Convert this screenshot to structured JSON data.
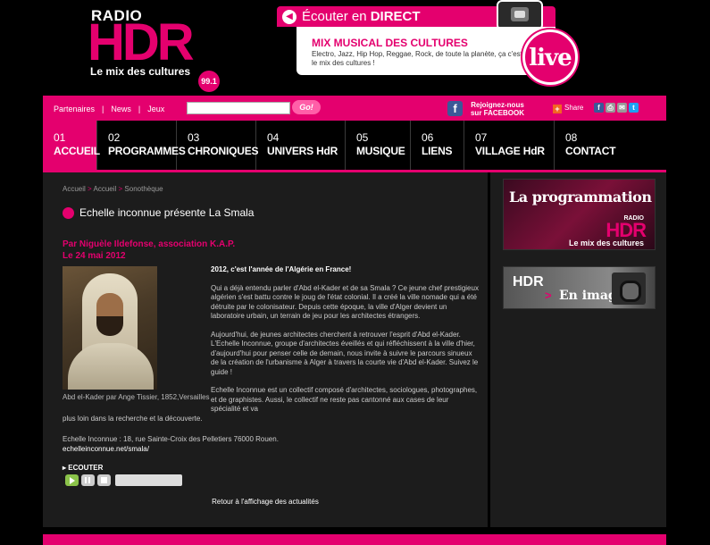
{
  "header": {
    "logo": {
      "radio": "RADIO",
      "hdr": "HDR",
      "tagline": "Le mix des cultures",
      "frequency": "99.1"
    },
    "live": {
      "listen_prefix": "Écouter en",
      "listen_bold": "DIRECT",
      "mix_title": "MIX MUSICAL DES CULTURES",
      "mix_text": "Electro, Jazz, Hip Hop, Reggae, Rock, de toute la planète, ça c'est le mix des cultures !",
      "live_label": "live"
    }
  },
  "topbar": {
    "links": [
      "Partenaires",
      "News",
      "Jeux"
    ],
    "search": {
      "value": "",
      "placeholder": ""
    },
    "go_label": "Go!",
    "facebook_text": "Rejoignez-nous sur FACEBOOK",
    "share_label": "Share",
    "social_icons": [
      "facebook-icon",
      "print-icon",
      "email-icon",
      "twitter-icon"
    ]
  },
  "nav": [
    {
      "num": "01",
      "label": "ACCUEIL",
      "active": true
    },
    {
      "num": "02",
      "label": "PROGRAMMES"
    },
    {
      "num": "03",
      "label": "CHRONIQUES"
    },
    {
      "num": "04",
      "label": "UNIVERS HdR"
    },
    {
      "num": "05",
      "label": "MUSIQUE"
    },
    {
      "num": "06",
      "label": "LIENS"
    },
    {
      "num": "07",
      "label": "VILLAGE HdR"
    },
    {
      "num": "08",
      "label": "CONTACT"
    }
  ],
  "breadcrumb": {
    "items": [
      "Accueil",
      "Accueil",
      "Sonothèque"
    ]
  },
  "article": {
    "title": "Echelle inconnue présente La Smala",
    "author": "Par Niguèle Ildefonse, association K.A.P.",
    "date": "Le 24 mai 2012",
    "image_caption": "Abd el-Kader par Ange Tissier, 1852,Versailles",
    "lead": "2012, c'est l'année de l'Algérie en France!",
    "p1": "Qui a déjà entendu parler d'Abd el-Kader et de sa Smala ? Ce jeune chef prestigieux algérien s'est battu contre le joug de l'état colonial. Il a créé la ville nomade qui a été détruite par le colonisateur. Depuis cette époque, la ville d'Alger devient un laboratoire urbain, un terrain de jeu pour les architectes étrangers.",
    "p2": "Aujourd'hui, de jeunes architectes cherchent à retrouver l'esprit d'Abd el-Kader. L'Echelle Inconnue, groupe d'architectes éveillés et qui réfléchissent à la ville d'hier, d'aujourd'hui pour penser celle de demain, nous invite à suivre le parcours sinueux de la création de l'urbanisme à Alger à travers la courte vie d'Abd el-Kader. Suivez le guide !",
    "p3": "Echelle Inconnue est un collectif composé d'architectes, sociologues, photographes, et de graphistes. Aussi, le collectif ne reste pas cantonné aux cases de leur spécialité et va",
    "p3_cont": "plus loin dans la recherche et la découverte.",
    "address": "Echelle Inconnue : 18, rue Sainte-Croix des Pelletiers 76000 Rouen.",
    "website": "echelleinconnue.net/smala/",
    "listen_label": "▸ ECOUTER",
    "back_link": "Retour à l'affichage des actualités"
  },
  "sidebar": {
    "promo1": {
      "title": "La programmation",
      "radio": "RADIO",
      "hdr": "HDR",
      "tagline": "Le mix des cultures"
    },
    "promo2": {
      "hdr": "HDR",
      "arrow": ">",
      "text": "En image"
    }
  },
  "colors": {
    "accent": "#e4006e",
    "facebook": "#3b5998",
    "twitter": "#1da1f2"
  }
}
